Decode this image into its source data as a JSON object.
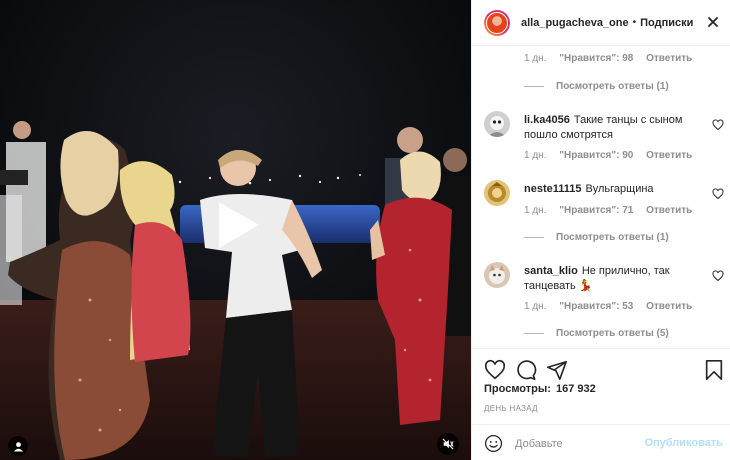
{
  "header": {
    "username": "alla_pugacheva_one",
    "dot": "•",
    "follow_label": "Подписки"
  },
  "comments": {
    "top_meta": {
      "time": "1 дн.",
      "likes": "\"Нравится\": 98",
      "reply": "Ответить"
    },
    "top_replies": "Посмотреть ответы (1)",
    "items": [
      {
        "username": "li.ka4056",
        "text": "Такие танцы с сыном пошло смотрятся",
        "time": "1 дн.",
        "likes": "\"Нравится\": 90",
        "reply": "Ответить"
      },
      {
        "username": "neste11115",
        "text": "Вульгарщина",
        "time": "1 дн.",
        "likes": "\"Нравится\": 71",
        "reply": "Ответить",
        "replies": "Посмотреть ответы (1)"
      },
      {
        "username": "santa_klio",
        "text": "Не прилично, так танцевать",
        "emoji": "💃",
        "time": "1 дн.",
        "likes": "\"Нравится\": 53",
        "reply": "Ответить",
        "replies": "Посмотреть ответы (5)"
      }
    ]
  },
  "stats": {
    "views_label": "Просмотры:",
    "views_count": "167 932",
    "posted": "ДЕНЬ НАЗАД"
  },
  "composer": {
    "placeholder": "Добавьте",
    "publish_label": "Опубликовать"
  },
  "colors": {
    "text": "#262626",
    "muted": "#8e8e8e",
    "publish_disabled": "#b2dffc",
    "divider": "#efefef"
  },
  "icons": [
    "play-icon",
    "user-tag-icon",
    "mute-icon",
    "more-icon",
    "heart-icon",
    "comment-icon",
    "share-icon",
    "bookmark-icon",
    "emoji-icon"
  ]
}
